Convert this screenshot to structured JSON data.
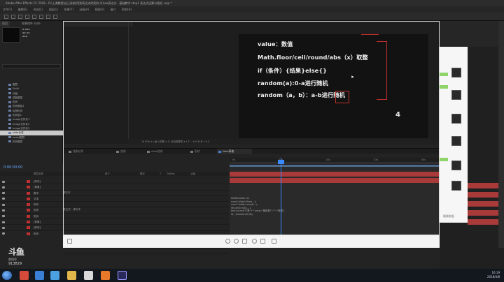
{
  "window": {
    "title": "Adobe After Effects CC 2018 - D:\\上课教程\\自己录制\\用到表达式的案例 (4)\\ae表达式 - 基础教学 step1 表达式运算与随机 .aep *",
    "menu": [
      "文件(F)",
      "编辑(E)",
      "合成(C)",
      "图层(L)",
      "效果(T)",
      "动画(A)",
      "视图(V)",
      "窗口",
      "帮助(H)"
    ]
  },
  "project_panel": {
    "tabs": [
      "项目",
      "效果控件 slide"
    ],
    "items": [
      "图层",
      "Solid",
      "动画",
      "调色图层",
      "形状",
      "形状图层1",
      "轮廓形状",
      "形状层1",
      "image文件夹1",
      "image文件夹2",
      "image文件夹3",
      "slide合成",
      "script图层",
      "形状图层"
    ],
    "selected_index": 11
  },
  "slide": {
    "lines": [
      "value：数值",
      "Math.floor/ceil/round/abs（x）取整",
      "if（条件）{结果}else{}",
      "random(a):0-a进行随机",
      "random（a，b）：a-b进行随机"
    ],
    "page_number": "4",
    "accent": "#c0302a"
  },
  "viewer": {
    "controls": "⊞  50%  ▾   ⌗  ◧   (完整)   ▾   ⊡   活动摄像机   ▾   1个...   ▾   ⊟  ⊞  ⊠   +0.0"
  },
  "timeline": {
    "tabs": [
      "渲染队列",
      "合成",
      "slide合成",
      "形状",
      "time表格"
    ],
    "active_tab": 4,
    "current_time": "0:00:00:00",
    "columns": [
      "图层名称",
      "单个",
      "模式",
      "T",
      "TrkMat",
      "父级"
    ],
    "layers": [
      "[形状]",
      "[背景]",
      "数字",
      "文本",
      "形状",
      "形状",
      "形状",
      "[背景]",
      "[形状]",
      "形状",
      "[slide]",
      "[背景]",
      "[背景]"
    ],
    "sub_labels": [
      "源文本",
      "表达式：源文本"
    ],
    "expression": [
      "fieldNumber=0;",
      "numX=Math.floor(...);",
      "numY=Math.round(...);",
      "if(numX>50){...}",
      "text=numX+\"数\"+\"\";else=\"随机数\"+\"\"+\"数据\";",
      "if(...)random(5,10);"
    ],
    "ruler_labels": [
      "0s",
      "01s",
      "02s",
      "03s",
      "04s"
    ]
  },
  "frame_toolbar": {
    "icons": [
      "zoom-in",
      "zoom-out",
      "fit",
      "rotate",
      "edit",
      "download"
    ]
  },
  "chat": {
    "label": "刚刚发起"
  },
  "watermark": {
    "logo": "斗鱼",
    "sub": "房间号",
    "room": "913829"
  },
  "taskbar": {
    "time": "16:19",
    "date": "2018/4/8"
  }
}
